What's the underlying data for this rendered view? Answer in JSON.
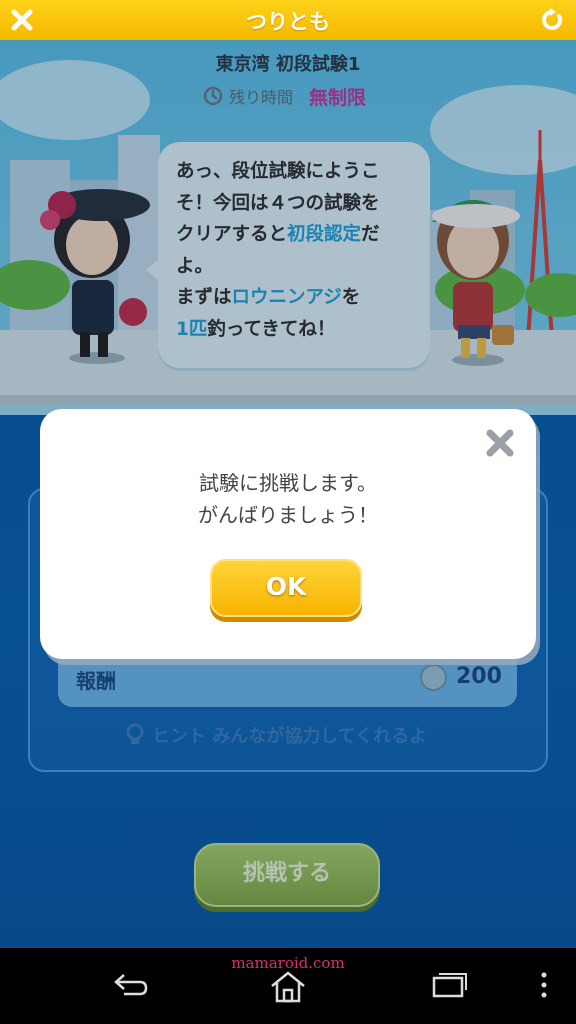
{
  "header": {
    "title": "つりとも"
  },
  "stage": {
    "name": "東京湾 初段試験1",
    "time_label": "残り時間",
    "time_value": "無制限"
  },
  "bubble": {
    "line1": "あっ、段位試験にようこ",
    "line2": "そ！今回は４つの試験を",
    "line3_a": "クリアすると",
    "line3_b": "初段認定",
    "line3_c": "だ",
    "line4": "よ。",
    "line5_a": "まずは",
    "line5_b": "ロウニンアジ",
    "line5_c": "を",
    "line6_a": "1匹",
    "line6_b": "釣ってきてね！"
  },
  "reward": {
    "label": "報酬",
    "amount": "200"
  },
  "hint": {
    "text": "ヒント みんなが協力してくれるよ"
  },
  "challenge_button": {
    "label": "挑戦する"
  },
  "dialog": {
    "line1": "試験に挑戦します。",
    "line2": "がんばりましょう！",
    "ok_label": "OK"
  },
  "watermark": "mamaroid.com",
  "colors": {
    "header": "#f5b800",
    "accent_text": "#21a3d8",
    "time_value": "#c03aa0",
    "ok_button": "#f7b300",
    "challenge_button": "#82aa48"
  }
}
